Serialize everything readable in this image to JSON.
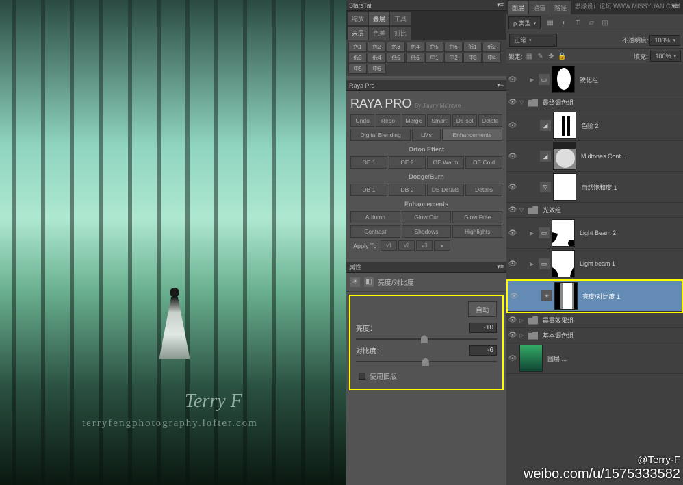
{
  "watermarks": {
    "artist": "Terry F",
    "url": "terryfengphotography.lofter.com",
    "top": "思缘设计论坛 WWW.MISSYUAN.COM",
    "weibo_handle": "@Terry-F",
    "weibo_url": "weibo.com/u/1575333582"
  },
  "starsTail": {
    "title": "StarsTail",
    "tabRow1": [
      "缩放",
      "叠层",
      "工具"
    ],
    "tabRow2": [
      "未层",
      "色差",
      "对比"
    ],
    "row1": [
      "色1",
      "色2",
      "色3",
      "色4",
      "色5",
      "色6"
    ],
    "row2": [
      "低1",
      "低2",
      "低3",
      "低4",
      "低5",
      "低6"
    ],
    "row3": [
      "中1",
      "中2",
      "中3",
      "中4",
      "中5",
      "中6"
    ]
  },
  "rayaPro": {
    "title": "Raya Pro",
    "brand": "RAYA PRO",
    "byline": "By Jimmy McIntyre",
    "row1": [
      "Undo",
      "Redo",
      "Merge",
      "Smart",
      "De-sel",
      "Delete"
    ],
    "modeTabs": [
      "Digital Blending",
      "LMs",
      "Enhancements"
    ],
    "sections": [
      {
        "name": "Orton Effect",
        "buttons": [
          "OE 1",
          "OE 2",
          "OE Warm",
          "OE Cold"
        ]
      },
      {
        "name": "Dodge/Burn",
        "buttons": [
          "DB 1",
          "DB 2",
          "DB Details",
          "Details"
        ]
      },
      {
        "name": "Enhancements",
        "buttons_a": [
          "Autumn",
          "Glow Cur",
          "Glow Free"
        ],
        "buttons_b": [
          "Contrast",
          "Shadows",
          "Highlights"
        ]
      }
    ],
    "applyTo": "Apply To",
    "applyBtns": [
      "v1",
      "v2",
      "v3"
    ]
  },
  "properties": {
    "title": "属性",
    "type": "亮度/对比度",
    "auto": "自动",
    "brightness_lbl": "亮度：",
    "brightness_val": "-10",
    "contrast_lbl": "对比度：",
    "contrast_val": "-6",
    "legacy": "使用旧版"
  },
  "layersPanel": {
    "tabs": [
      "图层",
      "通道",
      "路径"
    ],
    "typeFilter": "ρ 类型",
    "blendMode": "正常",
    "opacityLbl": "不透明度:",
    "opacityVal": "100%",
    "lockLbl": "锁定:",
    "fillLbl": "填充:",
    "fillVal": "100%",
    "layers": [
      {
        "type": "layer",
        "name": "锐化组",
        "indent": 1,
        "expand": "▶",
        "vis": "👁"
      },
      {
        "type": "group",
        "name": "最终调色组",
        "expand": "▽",
        "vis": "👁"
      },
      {
        "type": "adj",
        "name": "色阶 2",
        "indent": 2,
        "vis": "👁",
        "icon": "◢"
      },
      {
        "type": "adj",
        "name": "Midtones Cont...",
        "indent": 2,
        "vis": "👁",
        "icon": "◢"
      },
      {
        "type": "adj",
        "name": "自然饱和度 1",
        "indent": 2,
        "vis": "👁",
        "icon": "▽"
      },
      {
        "type": "group",
        "name": "光效组",
        "expand": "▽",
        "vis": "👁"
      },
      {
        "type": "layer",
        "name": "Light Beam 2",
        "indent": 2,
        "expand": "▶",
        "vis": "👁"
      },
      {
        "type": "layer",
        "name": "Light beam 1",
        "indent": 2,
        "expand": "▶",
        "vis": "👁"
      },
      {
        "type": "adj",
        "name": "亮度/对比度 1",
        "indent": 2,
        "vis": "👁",
        "icon": "☀",
        "selected": true
      },
      {
        "type": "group",
        "name": "晨雾效果组",
        "expand": "▷",
        "vis": "👁"
      },
      {
        "type": "group",
        "name": "基本调色组",
        "expand": "▷",
        "vis": "👁"
      },
      {
        "type": "bg",
        "name": "图层 ...",
        "vis": "👁"
      }
    ]
  }
}
